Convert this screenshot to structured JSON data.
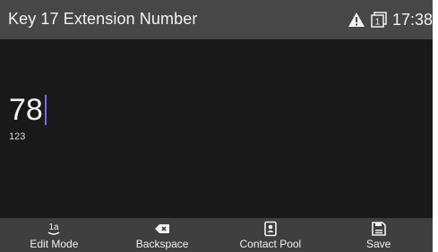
{
  "header": {
    "title": "Key 17 Extension Number",
    "time": "17:38",
    "status_icons": [
      "warning-icon",
      "line-1-icon"
    ],
    "line_number": "1"
  },
  "editor": {
    "value": "78",
    "input_mode": "123"
  },
  "softkeys": [
    {
      "label": "Edit Mode",
      "icon": "edit-mode-icon",
      "icon_text": "1a"
    },
    {
      "label": "Backspace",
      "icon": "backspace-icon"
    },
    {
      "label": "Contact Pool",
      "icon": "contact-pool-icon"
    },
    {
      "label": "Save",
      "icon": "save-icon"
    }
  ],
  "colors": {
    "titlebar": "#474747",
    "background": "#191919",
    "softkey_bar": "#3f3f3f",
    "caret": "#6d6cf0",
    "text": "#f2f2f2"
  }
}
